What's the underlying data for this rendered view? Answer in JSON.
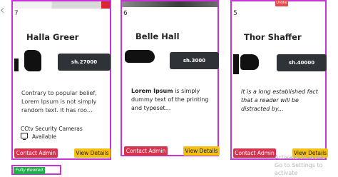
{
  "cards": [
    {
      "number": "7",
      "title": "Halla Greer",
      "price": "sh.27000",
      "description": "Contrary to popular belief, Lorem Ipsum is not simply random text. It has roo...",
      "category": "CCtv Security Cameras",
      "availability": "Available",
      "contact_label": "Contact Admin",
      "view_label": "View Details"
    },
    {
      "number": "6",
      "title": "Belle Hall",
      "price": "sh.3000",
      "description_bold": "Lorem Ipsum",
      "description": " is simply dummy text of the printing and typeset...",
      "contact_label": "Contact Admin",
      "view_label": "View Details"
    },
    {
      "number": "5",
      "title": "Thor Shaffer",
      "price": "sh.40000",
      "description": "It is a long established fact that a reader will be distracted by...",
      "contact_label": "Contact Admin",
      "view_label": "View Details",
      "badge": "Unlike"
    }
  ],
  "bottom": {
    "status_badge": "Fully Booked"
  },
  "overlay": {
    "line1": "Activate Windows",
    "line2": "Go to Settings to activate"
  },
  "colors": {
    "card_border": "#c733d4",
    "contact_button": "#d6334e",
    "view_button": "#f4c014",
    "price_tag": "#2f3237",
    "badge_green": "#1fae4b"
  }
}
